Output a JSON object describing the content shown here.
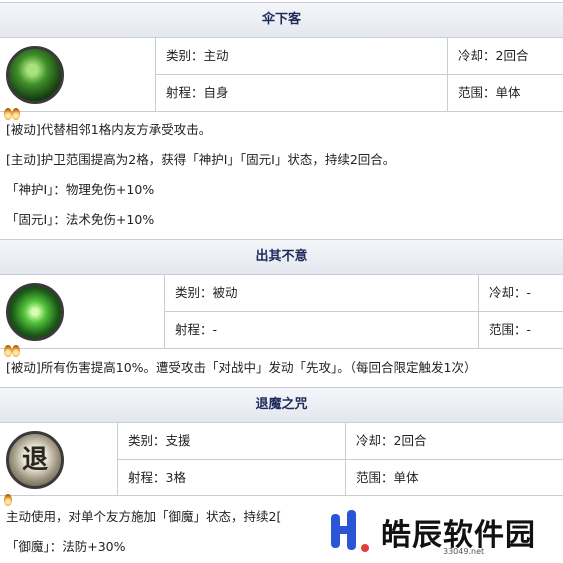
{
  "skills": [
    {
      "name": "伞下客",
      "type_label": "类别：主动",
      "cooldown_label": "冷却：2回合",
      "range_label": "射程：自身",
      "area_label": "范围：单体",
      "icon": "green-dragon-skill-icon",
      "desc": [
        "[被动]代替相邻1格内友方承受攻击。",
        "[主动]护卫范围提高为2格，获得「神护Ⅰ」「固元Ⅰ」状态，持续2回合。",
        "「神护Ⅰ」：物理免伤+10%",
        "「固元Ⅰ」：法术免伤+10%"
      ]
    },
    {
      "name": "出其不意",
      "type_label": "类别：被动",
      "cooldown_label": "冷却：-",
      "range_label": "射程：-",
      "area_label": "范围：-",
      "icon": "green-vortex-skill-icon",
      "desc": [
        "[被动]所有伤害提高10%。遭受攻击「对战中」发动「先攻」。（每回合限定触发1次）"
      ]
    },
    {
      "name": "退魔之咒",
      "type_label": "类别：支援",
      "cooldown_label": "冷却：2回合",
      "range_label": "射程：3格",
      "area_label": "范围：单体",
      "icon": "seal-character-skill-icon",
      "icon_glyph": "退",
      "desc": [
        "主动使用，对单个友方施加「御魔」状态，持续2[",
        "「御魔」：法防+30%"
      ]
    }
  ],
  "watermark": {
    "text": "皓辰软件园",
    "url": "33049.net"
  },
  "colors": {
    "header_text": "#1f2a5a",
    "header_bg": "#e4e7ef",
    "border": "#c9ccd4",
    "watermark_blue": "#2a56d6"
  }
}
